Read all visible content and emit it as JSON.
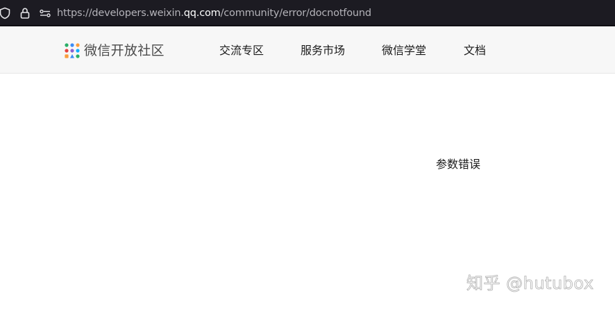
{
  "browser": {
    "url_prefix": "https://developers.weixin.",
    "url_host": "qq.com",
    "url_path": "/community/error/docnotfound",
    "icons": [
      "shield-icon",
      "lock-icon",
      "permissions-icon"
    ]
  },
  "header": {
    "logo_text": "微信开放社区",
    "logo_colors": [
      "#2aae67",
      "#3b8cf5",
      "#fa9d3b",
      "#e64340",
      "#8a63d2",
      "#10aeff"
    ],
    "nav": [
      {
        "label": "交流专区"
      },
      {
        "label": "服务市场"
      },
      {
        "label": "微信学堂"
      },
      {
        "label": "文档"
      }
    ]
  },
  "main": {
    "error_text": "参数错误"
  },
  "watermark": {
    "text": "知乎 @hutubox"
  }
}
